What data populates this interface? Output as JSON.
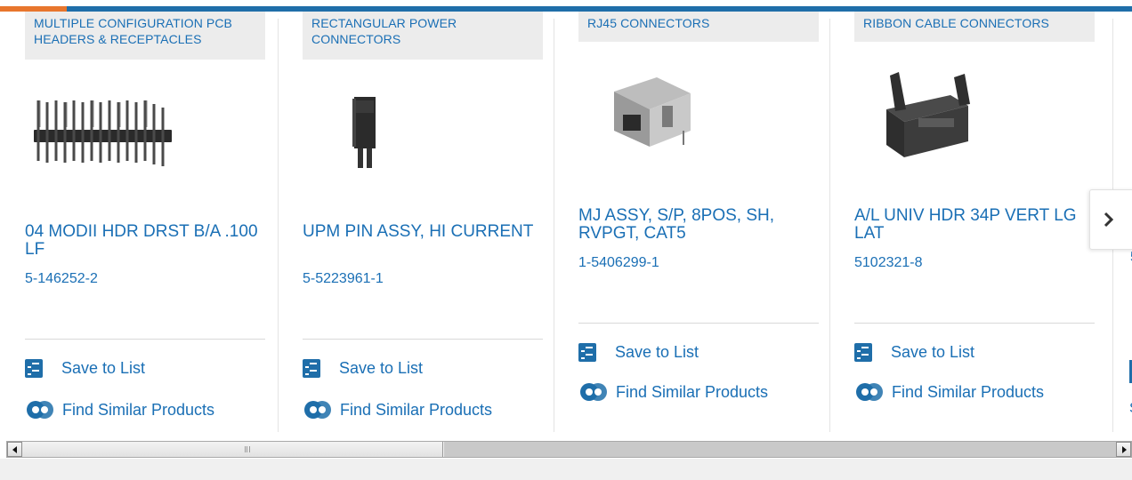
{
  "products": [
    {
      "category": "MULTIPLE CONFIGURATION PCB HEADERS & RECEPTACLES",
      "title": "04 MODII HDR DRST B/A .100 LF",
      "part_number": "5-146252-2",
      "image_icon": "pin-header-image",
      "save_label": "Save to List",
      "similar_label": "Find Similar Products"
    },
    {
      "category": "RECTANGULAR POWER CONNECTORS",
      "title": "UPM PIN ASSY, HI CURRENT",
      "part_number": "5-5223961-1",
      "image_icon": "power-connector-image",
      "save_label": "Save to List",
      "similar_label": "Find Similar Products"
    },
    {
      "category": "RJ45 CONNECTORS",
      "title": "MJ ASSY, S/P, 8POS, SH, RVPGT, CAT5",
      "part_number": "1-5406299-1",
      "image_icon": "rj45-jack-image",
      "save_label": "Save to List",
      "similar_label": "Find Similar Products"
    },
    {
      "category": "RIBBON CABLE CONNECTORS",
      "title": "A/L UNIV HDR 34P VERT LG LAT",
      "part_number": "5102321-8",
      "image_icon": "ribbon-header-image",
      "save_label": "Save to List",
      "similar_label": "Find Similar Products"
    }
  ],
  "partial_card": {
    "part_number_fragment": "5",
    "similar_fragment": "S"
  },
  "next_button": {
    "icon": "chevron-right-icon"
  },
  "colors": {
    "brand_blue": "#1a6fb5",
    "accent_orange": "#e8762d",
    "topbar_blue": "#1f6ea9"
  }
}
